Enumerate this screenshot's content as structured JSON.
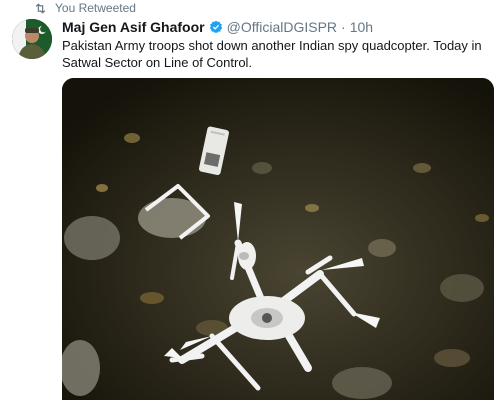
{
  "retweet": {
    "icon": "retweet-icon",
    "label": "You Retweeted"
  },
  "tweet": {
    "author_name": "Maj Gen Asif Ghafoor",
    "handle": "@OfficialDGISPR",
    "separator": "·",
    "time": "10h",
    "verified": true,
    "text": "Pakistan Army troops shot down another Indian spy quadcopter. Today in Satwal Sector on Line of Control.",
    "media_alt": "photo of a downed white quadcopter drone lying among rocks and dry leaves at night"
  },
  "colors": {
    "muted": "#657786",
    "text": "#14171a",
    "verified": "#1da1f2",
    "media_bg": "#1c1a14"
  }
}
